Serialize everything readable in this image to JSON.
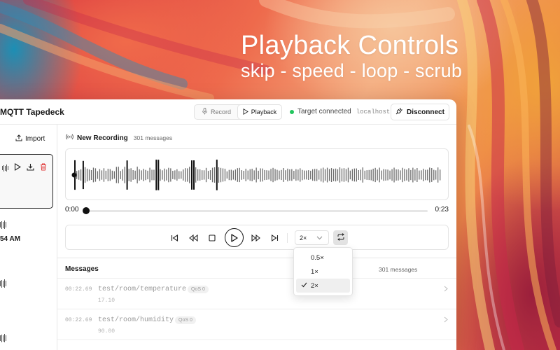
{
  "headline": {
    "title": "Playback Controls",
    "subtitle": "skip - speed - loop - scrub"
  },
  "app": {
    "title": "MQTT Tapedeck"
  },
  "mode": {
    "record": "Record",
    "playback": "Playback",
    "active": "playback"
  },
  "connection": {
    "status": "Target connected",
    "host": "localhost",
    "status_color": "#22c55e",
    "disconnect": "Disconnect"
  },
  "sidebar": {
    "import": "Import",
    "time_fragment": "54 AM"
  },
  "recording": {
    "title": "New Recording",
    "count": "301 messages"
  },
  "scrubber": {
    "current": "0:00",
    "total": "0:23",
    "progress": 0
  },
  "transport": {
    "icons": [
      "skip-back-icon",
      "rewind-icon",
      "stop-icon",
      "play-icon",
      "fast-forward-icon",
      "skip-forward-icon"
    ],
    "speed_value": "2×",
    "loop_enabled": true
  },
  "speed_menu": {
    "options": [
      "0.5×",
      "1×",
      "2×"
    ],
    "selected": "2×"
  },
  "messages": {
    "label": "Messages",
    "count": "301 messages",
    "items": [
      {
        "time": "00:22.69",
        "topic": "test/room/temperature",
        "qos": "QoS 0",
        "value": "17.10"
      },
      {
        "time": "00:22.69",
        "topic": "test/room/humidity",
        "qos": "QoS 0",
        "value": "90.00"
      }
    ]
  }
}
